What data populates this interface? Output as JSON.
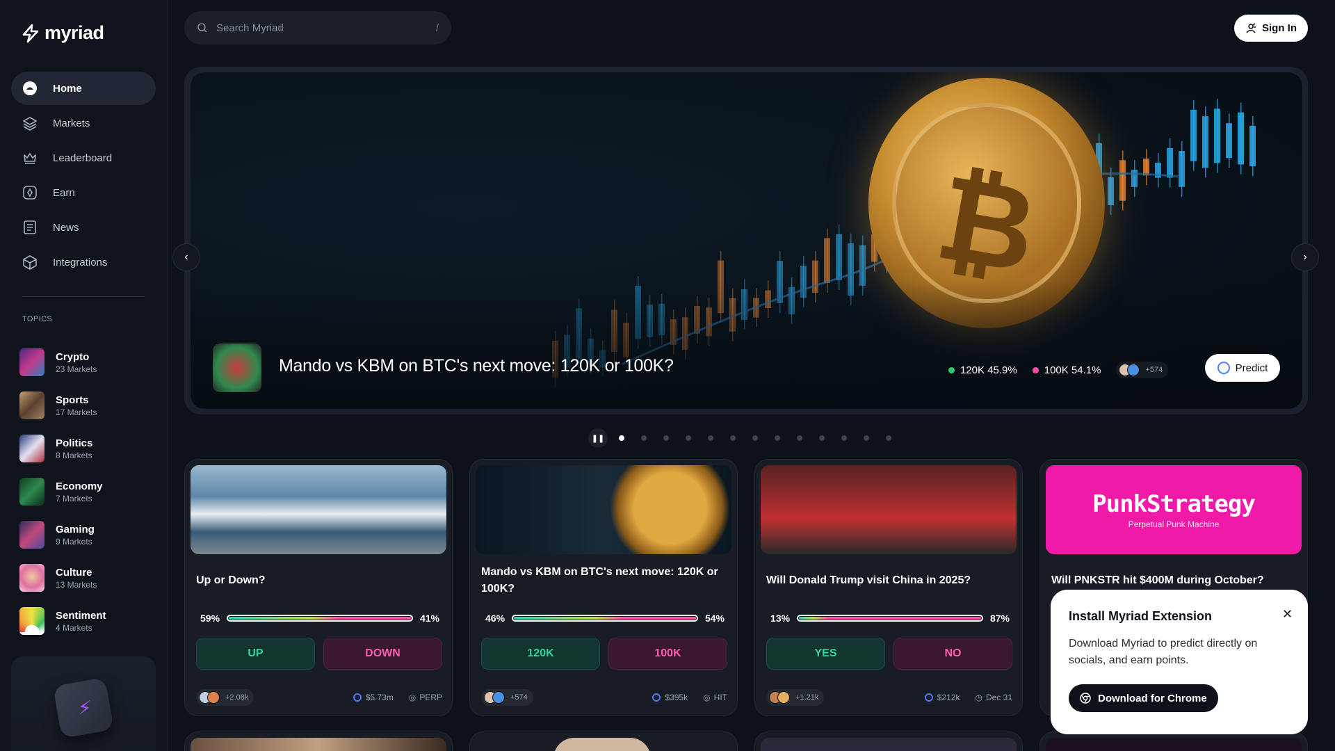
{
  "brand": {
    "name": "myriad"
  },
  "nav": [
    {
      "label": "Home",
      "icon": "home-icon",
      "active": true
    },
    {
      "label": "Markets",
      "icon": "layers-icon"
    },
    {
      "label": "Leaderboard",
      "icon": "crown-icon"
    },
    {
      "label": "Earn",
      "icon": "earn-icon"
    },
    {
      "label": "News",
      "icon": "news-icon"
    },
    {
      "label": "Integrations",
      "icon": "cube-icon"
    }
  ],
  "topics": {
    "label": "TOPICS",
    "items": [
      {
        "name": "Crypto",
        "count": "23 Markets",
        "color": "#c23a8a"
      },
      {
        "name": "Sports",
        "count": "17 Markets",
        "color": "#8a6a4a"
      },
      {
        "name": "Politics",
        "count": "8 Markets",
        "color": "#b03040"
      },
      {
        "name": "Economy",
        "count": "7 Markets",
        "color": "#1f6a3a"
      },
      {
        "name": "Gaming",
        "count": "9 Markets",
        "color": "#4a4aa0"
      },
      {
        "name": "Culture",
        "count": "13 Markets",
        "color": "#e070a0"
      },
      {
        "name": "Sentiment",
        "count": "4 Markets",
        "color": "#f0a040"
      }
    ]
  },
  "search": {
    "placeholder": "Search Myriad",
    "shortcut": "/"
  },
  "header": {
    "signin_label": "Sign In"
  },
  "hero": {
    "title": "Mando vs KBM on BTC's next move: 120K or 100K?",
    "outcome_a": "120K 45.9%",
    "outcome_b": "100K 54.1%",
    "participants": "+574",
    "predict_label": "Predict",
    "color_a": "#2ecc71",
    "color_b": "#ff4fa8"
  },
  "pager": {
    "count": 13,
    "active": 0
  },
  "cards": [
    {
      "question": "Up or Down?",
      "left_pct": "59%",
      "right_pct": "41%",
      "fill": 0.59,
      "yes_label": "UP",
      "no_label": "DOWN",
      "participants": "+2.08k",
      "volume": "$5.73m",
      "tag": "PERP"
    },
    {
      "question": "Mando vs KBM on BTC's next move: 120K or 100K?",
      "left_pct": "46%",
      "right_pct": "54%",
      "fill": 0.46,
      "yes_label": "120K",
      "no_label": "100K",
      "participants": "+574",
      "volume": "$395k",
      "tag": "HIT"
    },
    {
      "question": "Will Donald Trump visit China in 2025?",
      "left_pct": "13%",
      "right_pct": "87%",
      "fill": 0.13,
      "yes_label": "YES",
      "no_label": "NO",
      "participants": "+1.21k",
      "volume": "$212k",
      "tag": "Dec 31"
    },
    {
      "question": "Will PNKSTR hit $400M during October?",
      "brand_title": "PunkStrategy",
      "brand_sub": "Perpetual Punk Machine"
    }
  ],
  "popup": {
    "title": "Install Myriad Extension",
    "body": "Download Myriad to predict directly on socials, and earn points.",
    "button": "Download for Chrome"
  }
}
